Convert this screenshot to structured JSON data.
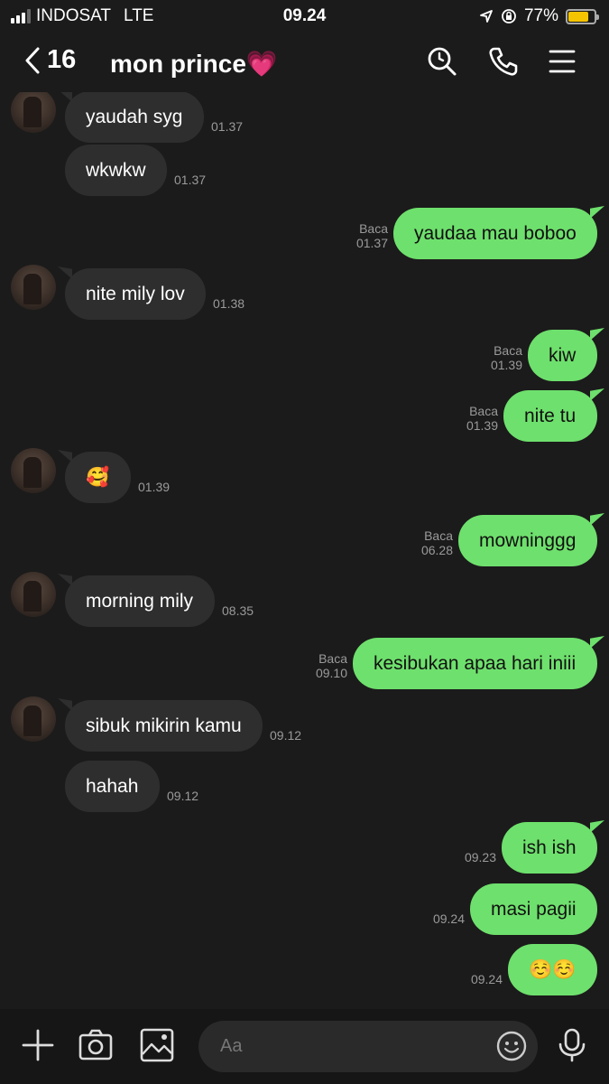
{
  "status_bar": {
    "carrier": "INDOSAT",
    "network": "LTE",
    "time": "09.24",
    "battery": "77%",
    "battery_level": 0.77
  },
  "header": {
    "back_count": "16",
    "title": "mon prince💗"
  },
  "messages": [
    {
      "side": "in",
      "text": "yaudah syg",
      "time": "01.37",
      "read": "",
      "avatar": true
    },
    {
      "side": "in",
      "text": "wkwkw",
      "time": "01.37",
      "read": "",
      "avatar": false
    },
    {
      "side": "out",
      "text": "yaudaa mau boboo",
      "time": "01.37",
      "read": "Baca"
    },
    {
      "side": "in",
      "text": "nite mily lov",
      "time": "01.38",
      "read": "",
      "avatar": true
    },
    {
      "side": "out",
      "text": "kiw",
      "time": "01.39",
      "read": "Baca"
    },
    {
      "side": "out",
      "text": "nite tu",
      "time": "01.39",
      "read": "Baca"
    },
    {
      "side": "in",
      "text": "🥰",
      "time": "01.39",
      "read": "",
      "avatar": true
    },
    {
      "side": "out",
      "text": "mowninggg",
      "time": "06.28",
      "read": "Baca"
    },
    {
      "side": "in",
      "text": "morning mily",
      "time": "08.35",
      "read": "",
      "avatar": true
    },
    {
      "side": "out",
      "text": "kesibukan apaa hari iniii",
      "time": "09.10",
      "read": "Baca"
    },
    {
      "side": "in",
      "text": "sibuk mikirin kamu",
      "time": "09.12",
      "read": "",
      "avatar": true
    },
    {
      "side": "in",
      "text": "hahah",
      "time": "09.12",
      "read": "",
      "avatar": false
    },
    {
      "side": "out",
      "text": "ish ish",
      "time": "09.23",
      "read": ""
    },
    {
      "side": "out",
      "text": "masi pagii",
      "time": "09.24",
      "read": ""
    },
    {
      "side": "out",
      "text": "☺️☺️",
      "time": "09.24",
      "read": ""
    }
  ],
  "input": {
    "placeholder": "Aa"
  },
  "icons": {
    "header": [
      "back-icon",
      "search-icon",
      "phone-icon",
      "menu-icon"
    ],
    "input_bar": [
      "plus-icon",
      "camera-icon",
      "image-icon",
      "emoji-icon",
      "microphone-icon"
    ]
  },
  "colors": {
    "background": "#1b1b1b",
    "incoming_bubble": "#2e2e2e",
    "outgoing_bubble": "#6ee06d",
    "battery": "#f5c400"
  }
}
